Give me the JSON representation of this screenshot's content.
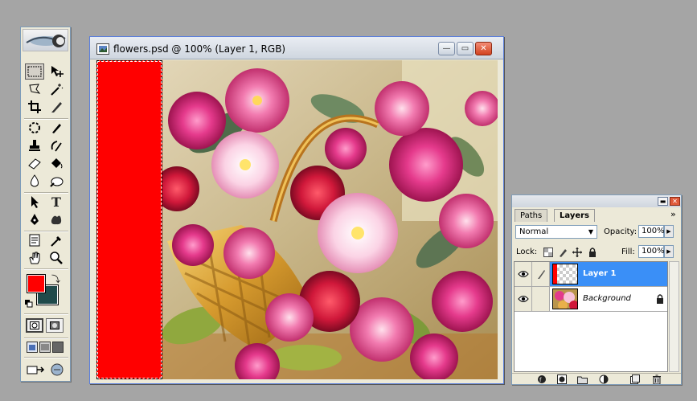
{
  "document": {
    "title": "flowers.psd @ 100% (Layer 1, RGB)",
    "buttons": {
      "minimize": "—",
      "restore": "▭",
      "close": "✕"
    }
  },
  "toolbox": {
    "tools": [
      {
        "name": "rectangular-marquee-tool-icon",
        "active": true
      },
      {
        "name": "move-tool-icon"
      },
      {
        "name": "lasso-tool-icon"
      },
      {
        "name": "magic-wand-tool-icon"
      },
      {
        "name": "crop-tool-icon"
      },
      {
        "name": "slice-tool-icon"
      },
      {
        "name": "healing-brush-tool-icon"
      },
      {
        "name": "brush-tool-icon"
      },
      {
        "name": "clone-stamp-tool-icon"
      },
      {
        "name": "history-brush-tool-icon"
      },
      {
        "name": "eraser-tool-icon"
      },
      {
        "name": "paint-bucket-tool-icon"
      },
      {
        "name": "blur-tool-icon"
      },
      {
        "name": "dodge-tool-icon"
      },
      {
        "name": "path-selection-tool-icon"
      },
      {
        "name": "type-tool-icon",
        "glyph": "T"
      },
      {
        "name": "pen-tool-icon"
      },
      {
        "name": "custom-shape-tool-icon"
      },
      {
        "name": "notes-tool-icon"
      },
      {
        "name": "eyedropper-tool-icon"
      },
      {
        "name": "hand-tool-icon"
      },
      {
        "name": "zoom-tool-icon"
      }
    ],
    "foreground_color": "#ff0000",
    "background_color": "#1f4a4a"
  },
  "layers_panel": {
    "tabs": [
      "Paths",
      "Layers"
    ],
    "active_tab": "Layers",
    "menu_glyph": "»",
    "blend_mode": "Normal",
    "opacity_label": "Opacity:",
    "opacity_value": "100%",
    "lock_label": "Lock:",
    "fill_label": "Fill:",
    "fill_value": "100%",
    "layers": [
      {
        "name": "Layer 1",
        "selected": true,
        "visible": true
      },
      {
        "name": "Background",
        "selected": false,
        "visible": true,
        "locked": true
      }
    ]
  },
  "colors": {
    "selection_blue": "#3a8ff7",
    "red_layer": "#ff0000"
  }
}
